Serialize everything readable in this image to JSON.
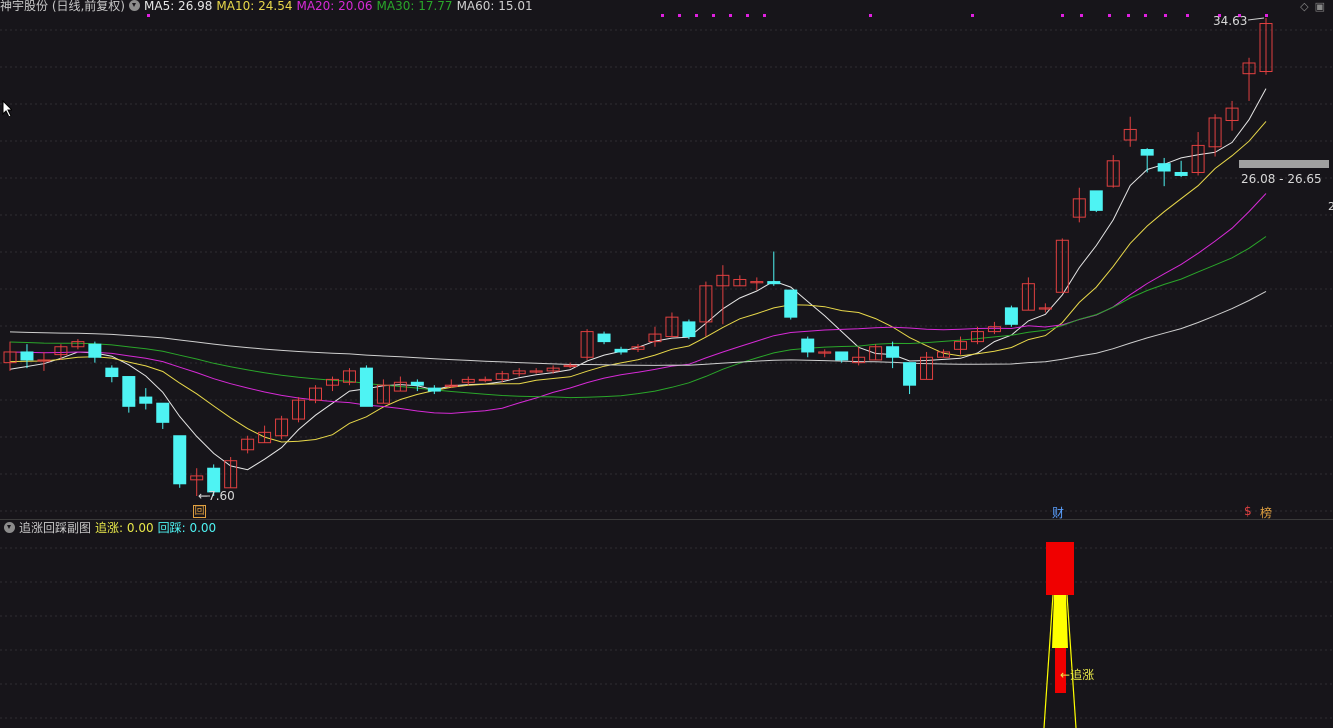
{
  "stock": {
    "title": "神宇股份 (日线,前复权)"
  },
  "ma_legend": [
    {
      "label": "MA5: 26.98",
      "color": "#e6e6e6"
    },
    {
      "label": "MA10: 24.54",
      "color": "#e8d84a"
    },
    {
      "label": "MA20: 20.06",
      "color": "#d62ad6"
    },
    {
      "label": "MA30: 17.77",
      "color": "#2aa62a"
    },
    {
      "label": "MA60: 15.01",
      "color": "#cfcfcf"
    }
  ],
  "price_annotations": {
    "high_label": "34.63",
    "low_label": "7.60",
    "range_label": "26.08 - 26.65",
    "edge_value": "2"
  },
  "markers": {
    "hui": "回",
    "cai": "财",
    "dollar": "$",
    "bang": "榜"
  },
  "sub_indicator": {
    "name": "追涨回踩副图",
    "zhuizhang_label": "追涨: 0.00",
    "huicai_label": "回踩: 0.00",
    "signal_label": "追涨"
  },
  "colors": {
    "up": "#e04040",
    "down": "#4ef3f3",
    "background": "#17151a",
    "grid": "#2f2d33",
    "dots": "#e020e0"
  },
  "chart_data": {
    "type": "candlestick",
    "series_names": [
      "MA5",
      "MA10",
      "MA20",
      "MA30",
      "MA60"
    ],
    "candles": [
      [
        11.6,
        12.0,
        11.3,
        12.4
      ],
      [
        12.0,
        11.7,
        11.4,
        12.3
      ],
      [
        11.7,
        11.7,
        11.3,
        12.0
      ],
      [
        11.9,
        12.2,
        11.7,
        12.3
      ],
      [
        12.2,
        12.4,
        12.1,
        12.5
      ],
      [
        12.3,
        11.8,
        11.6,
        12.4
      ],
      [
        11.4,
        11.1,
        10.9,
        11.5
      ],
      [
        11.1,
        10.1,
        9.9,
        11.1
      ],
      [
        10.4,
        10.2,
        10.0,
        10.7
      ],
      [
        10.2,
        9.6,
        9.4,
        10.2
      ],
      [
        9.2,
        7.9,
        7.8,
        9.2
      ],
      [
        8.0,
        8.1,
        7.6,
        8.3
      ],
      [
        8.3,
        7.7,
        7.6,
        8.4
      ],
      [
        7.8,
        8.5,
        7.8,
        8.6
      ],
      [
        8.8,
        9.1,
        8.7,
        9.2
      ],
      [
        9.0,
        9.3,
        9.0,
        9.5
      ],
      [
        9.2,
        9.7,
        9.1,
        9.8
      ],
      [
        9.7,
        10.3,
        9.6,
        10.4
      ],
      [
        10.3,
        10.7,
        10.2,
        10.8
      ],
      [
        10.8,
        11.0,
        10.6,
        11.1
      ],
      [
        10.9,
        11.3,
        10.8,
        11.4
      ],
      [
        11.4,
        10.1,
        10.1,
        11.5
      ],
      [
        10.2,
        10.8,
        10.2,
        11.0
      ],
      [
        10.6,
        10.9,
        10.6,
        11.1
      ],
      [
        10.9,
        10.8,
        10.6,
        11.0
      ],
      [
        10.7,
        10.6,
        10.5,
        10.8
      ],
      [
        10.8,
        10.8,
        10.7,
        11.0
      ],
      [
        10.9,
        11.0,
        10.8,
        11.1
      ],
      [
        11.0,
        11.0,
        10.9,
        11.1
      ],
      [
        11.0,
        11.2,
        10.9,
        11.3
      ],
      [
        11.2,
        11.3,
        11.1,
        11.4
      ],
      [
        11.3,
        11.3,
        11.2,
        11.4
      ],
      [
        11.3,
        11.4,
        11.2,
        11.5
      ],
      [
        11.5,
        11.5,
        11.4,
        11.6
      ],
      [
        11.8,
        12.8,
        11.7,
        12.9
      ],
      [
        12.7,
        12.4,
        12.3,
        12.8
      ],
      [
        12.1,
        12.0,
        11.9,
        12.2
      ],
      [
        12.1,
        12.2,
        12.0,
        12.3
      ],
      [
        12.4,
        12.7,
        12.2,
        13.0
      ],
      [
        12.6,
        13.4,
        12.6,
        13.6
      ],
      [
        13.2,
        12.6,
        12.5,
        13.3
      ],
      [
        13.2,
        14.8,
        12.6,
        15.0
      ],
      [
        14.8,
        15.3,
        13.1,
        15.8
      ],
      [
        14.8,
        15.1,
        14.8,
        15.3
      ],
      [
        15.0,
        15.0,
        14.6,
        15.2
      ],
      [
        15.0,
        14.9,
        14.8,
        16.5
      ],
      [
        14.6,
        13.4,
        13.3,
        14.6
      ],
      [
        12.5,
        12.0,
        11.8,
        12.6
      ],
      [
        12.0,
        12.0,
        11.8,
        12.1
      ],
      [
        12.0,
        11.7,
        11.6,
        12.0
      ],
      [
        11.6,
        11.8,
        11.5,
        12.2
      ],
      [
        11.7,
        12.2,
        11.7,
        12.3
      ],
      [
        12.2,
        11.8,
        11.4,
        12.4
      ],
      [
        11.6,
        10.8,
        10.5,
        11.6
      ],
      [
        11.0,
        11.8,
        11.0,
        12.0
      ],
      [
        11.8,
        12.0,
        11.8,
        12.1
      ],
      [
        12.1,
        12.4,
        11.9,
        12.6
      ],
      [
        12.4,
        12.8,
        12.3,
        13.0
      ],
      [
        12.8,
        13.0,
        12.7,
        13.2
      ],
      [
        13.8,
        13.1,
        13.0,
        13.9
      ],
      [
        13.7,
        14.9,
        13.7,
        15.2
      ],
      [
        13.8,
        13.8,
        13.6,
        14.0
      ],
      [
        14.5,
        17.1,
        14.5,
        17.2
      ],
      [
        18.4,
        19.5,
        18.1,
        20.2
      ],
      [
        20.0,
        18.8,
        18.7,
        20.0
      ],
      [
        20.3,
        22.0,
        20.2,
        22.4
      ],
      [
        23.5,
        24.3,
        23.0,
        25.3
      ],
      [
        22.8,
        22.4,
        21.2,
        22.9
      ],
      [
        21.8,
        21.3,
        20.3,
        22.2
      ],
      [
        21.2,
        21.0,
        20.9,
        22.0
      ],
      [
        21.2,
        23.1,
        21.0,
        24.1
      ],
      [
        23.0,
        25.2,
        22.3,
        25.5
      ],
      [
        25.0,
        26.0,
        24.2,
        26.6
      ],
      [
        29.0,
        30.0,
        26.6,
        30.5
      ],
      [
        29.2,
        34.0,
        28.9,
        34.6
      ]
    ]
  }
}
